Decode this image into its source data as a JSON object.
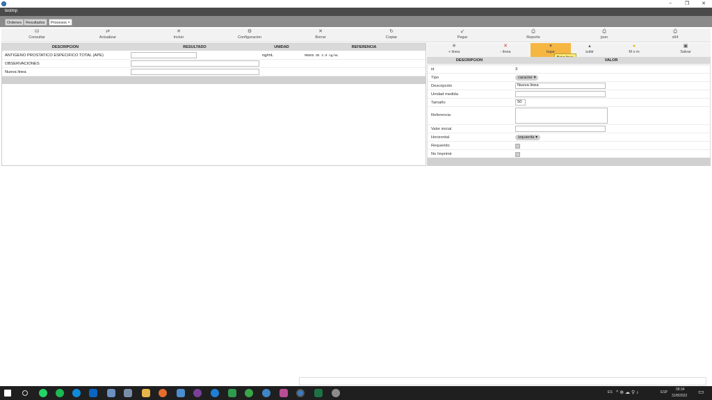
{
  "window": {
    "title": "testmp",
    "min": "−",
    "restore": "❐",
    "close": "✕"
  },
  "tabs": [
    {
      "label": "Ordenes"
    },
    {
      "label": "Resultados"
    },
    {
      "label": "Procesos ×"
    }
  ],
  "toolbar": [
    {
      "label": "Consultar",
      "icon": "search-icon",
      "glyph": "⛁"
    },
    {
      "label": "Actualizar",
      "icon": "refresh-icon",
      "glyph": "⇄"
    },
    {
      "label": "Incluir",
      "icon": "add-icon",
      "glyph": "✳"
    },
    {
      "label": "Configuracion",
      "icon": "settings-icon",
      "glyph": "⚙"
    },
    {
      "label": "Borrar",
      "icon": "delete-icon",
      "glyph": "✕"
    },
    {
      "label": "Copiar",
      "icon": "copy-icon",
      "glyph": "↻"
    },
    {
      "label": "Pegar",
      "icon": "paste-icon",
      "glyph": "↙"
    },
    {
      "label": "Reporte",
      "icon": "printer-icon",
      "glyph": "⎙"
    },
    {
      "label": "json",
      "icon": "printer-icon",
      "glyph": "⎙"
    },
    {
      "label": "x64",
      "icon": "printer-icon",
      "glyph": "⎙"
    }
  ],
  "grid": {
    "headers": [
      "DESCRIPCION",
      "RESULTADO",
      "UNIDAD",
      "REFERENCIA"
    ],
    "rows": [
      {
        "descripcion": "ANTIGENO PROSTATICO ESPECIFICO TOTAL (APE)",
        "unidad": "ng/mL",
        "referencia": "MENOS DE 4.0 ng/mL"
      },
      {
        "descripcion": "OBSERVACIONES",
        "unidad": "",
        "referencia": ""
      },
      {
        "descripcion": "Nueva linea",
        "unidad": "",
        "referencia": ""
      }
    ]
  },
  "right_toolbar": [
    {
      "label": "+ linea",
      "icon": "add-line-icon",
      "glyph": "✳"
    },
    {
      "label": "- linea",
      "icon": "remove-line-icon",
      "glyph": "✕"
    },
    {
      "label": "bajar",
      "icon": "move-down-icon",
      "glyph": "▾"
    },
    {
      "label": "subir",
      "icon": "move-up-icon",
      "glyph": "▴"
    },
    {
      "label": "M o m",
      "icon": "star-icon",
      "glyph": "●"
    },
    {
      "label": "Salvar",
      "icon": "save-icon",
      "glyph": "▣"
    }
  ],
  "tooltip": "Bajar linea",
  "props": {
    "headers": [
      "DESCRIPCION",
      "VALOR"
    ],
    "id_label": "id",
    "id_value": "3",
    "tipo_label": "Tipo",
    "tipo_value": "caracter",
    "descripcion_label": "Descripción",
    "descripcion_value": "Nueva linea",
    "unidad_label": "Unidad medida",
    "tamano_label": "Tamaño",
    "tamano_value": "50",
    "referencia_label": "Referencia",
    "valor_label": "Valor inicial",
    "horizontal_label": "Horizontal",
    "horizontal_value": "izquierda",
    "requerido_label": "Requerido",
    "noimprimir_label": "No Imprimir"
  },
  "taskbar": {
    "lang": "ES",
    "lang2": "ESP",
    "time": "08:34",
    "date": "31/8/2022"
  }
}
